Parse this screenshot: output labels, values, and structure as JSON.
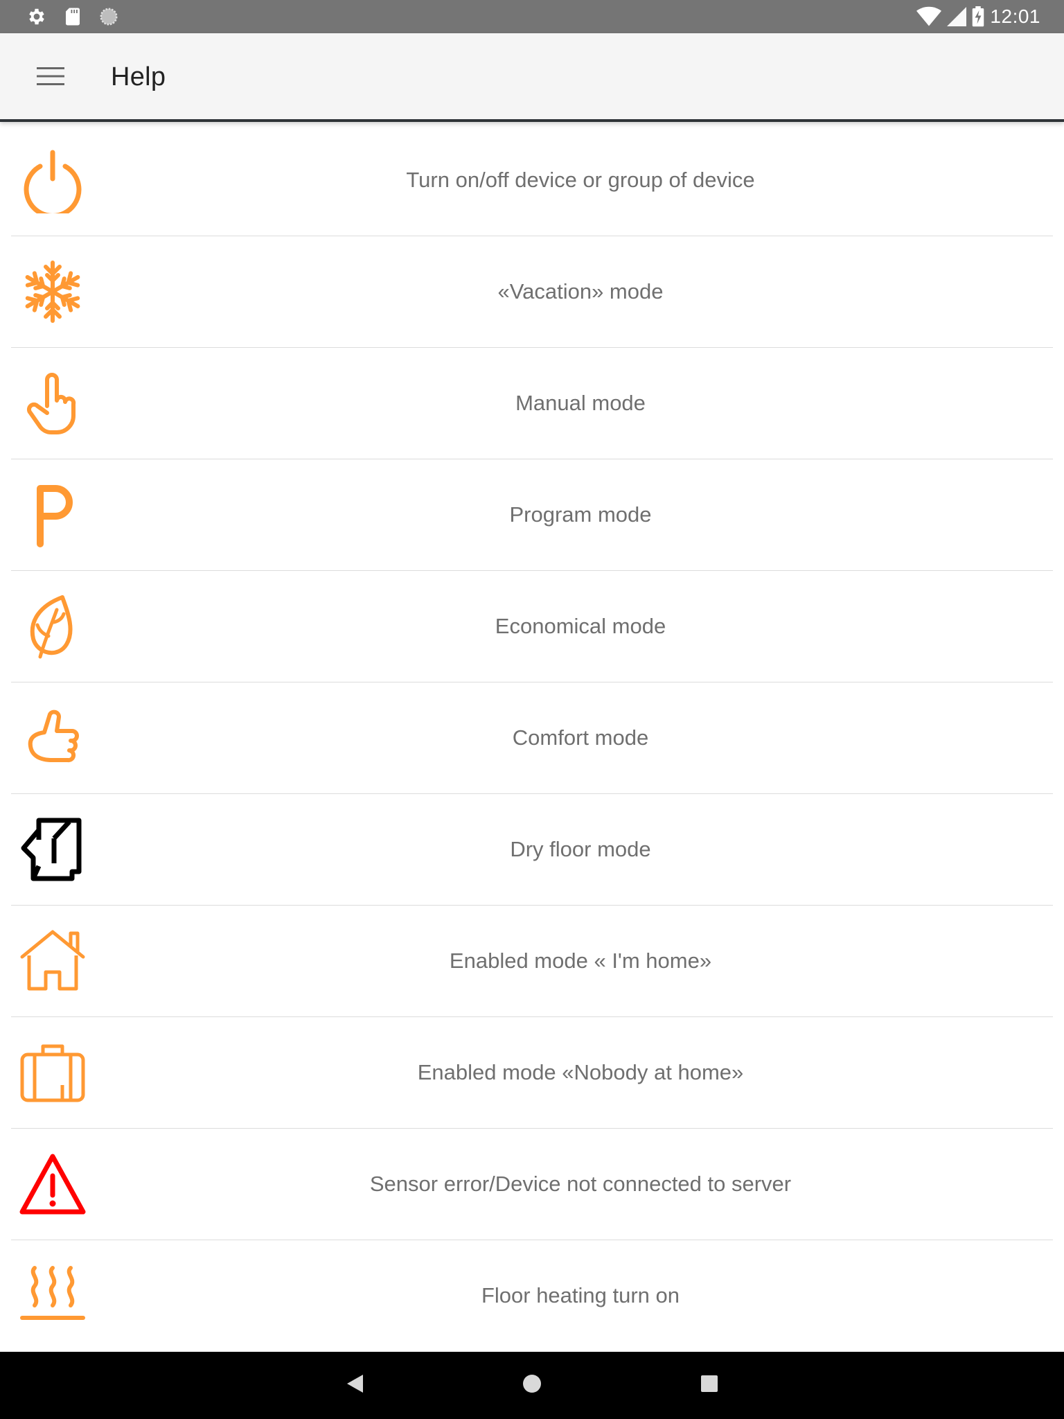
{
  "status_bar": {
    "time": "12:01",
    "left_icons": [
      "gear-icon",
      "sd-card-icon",
      "sync-icon"
    ],
    "right_icons": [
      "wifi-icon",
      "signal-icon",
      "battery-charging-icon"
    ]
  },
  "app_bar": {
    "title": "Help",
    "menu_icon": "hamburger-menu-icon"
  },
  "help_items": [
    {
      "icon": "power-icon",
      "label": "Turn on/off device or group of device",
      "color": "#ff9933"
    },
    {
      "icon": "snowflake-icon",
      "label": "«Vacation» mode",
      "color": "#ff9933"
    },
    {
      "icon": "pointing-hand-icon",
      "label": "Manual mode",
      "color": "#ff9933"
    },
    {
      "icon": "program-p-icon",
      "label": "Program mode",
      "color": "#ff9933"
    },
    {
      "icon": "leaf-icon",
      "label": "Economical mode",
      "color": "#ff9933"
    },
    {
      "icon": "thumbs-up-icon",
      "label": "Comfort mode",
      "color": "#ff9933"
    },
    {
      "icon": "dry-floor-icon",
      "label": "Dry floor mode",
      "color": "#000000"
    },
    {
      "icon": "house-icon",
      "label": "Enabled mode « I'm home»",
      "color": "#ff9933"
    },
    {
      "icon": "suitcase-icon",
      "label": "Enabled mode «Nobody at home»",
      "color": "#ff9933"
    },
    {
      "icon": "warning-icon",
      "label": "Sensor error/Device not connected to server",
      "color": "#ff0000"
    },
    {
      "icon": "floor-heating-icon",
      "label": "Floor heating turn on",
      "color": "#ff9933"
    }
  ],
  "nav_bar": {
    "back_icon": "back-triangle-icon",
    "home_icon": "home-circle-icon",
    "recents_icon": "recents-square-icon"
  }
}
